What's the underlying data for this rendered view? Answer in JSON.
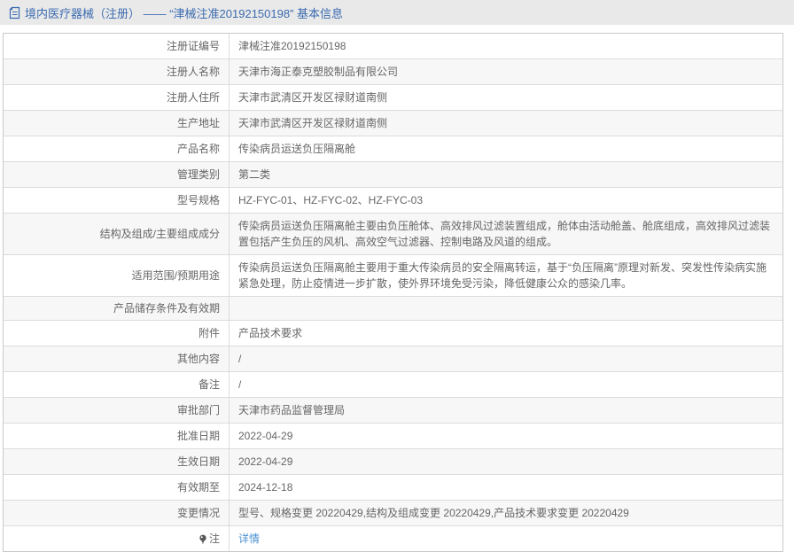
{
  "header": {
    "icon": "document-icon",
    "title": "境内医疗器械（注册） ——  “津械注准20192150198”  基本信息"
  },
  "table": {
    "rows": [
      {
        "label": "注册证编号",
        "value": "津械注准20192150198"
      },
      {
        "label": "注册人名称",
        "value": "天津市海正泰克塑胶制品有限公司"
      },
      {
        "label": "注册人住所",
        "value": "天津市武清区开发区禄财道南侧"
      },
      {
        "label": "生产地址",
        "value": "天津市武清区开发区禄财道南侧"
      },
      {
        "label": "产品名称",
        "value": "传染病员运送负压隔离舱"
      },
      {
        "label": "管理类别",
        "value": "第二类"
      },
      {
        "label": "型号规格",
        "value": "HZ-FYC-01、HZ-FYC-02、HZ-FYC-03"
      },
      {
        "label": "结构及组成/主要组成成分",
        "value": "传染病员运送负压隔离舱主要由负压舱体、高效排风过滤装置组成，舱体由活动舱盖、舱底组成，高效排风过滤装置包括产生负压的风机、高效空气过滤器、控制电路及风道的组成。"
      },
      {
        "label": "适用范围/预期用途",
        "value": "传染病员运送负压隔离舱主要用于重大传染病员的安全隔离转运，基于“负压隔离”原理对新发、突发性传染病实施紧急处理，防止疫情进一步扩散，使外界环境免受污染，降低健康公众的感染几率。"
      },
      {
        "label": "产品储存条件及有效期",
        "value": ""
      },
      {
        "label": "附件",
        "value": "产品技术要求"
      },
      {
        "label": "其他内容",
        "value": "/"
      },
      {
        "label": "备注",
        "value": "/"
      },
      {
        "label": "审批部门",
        "value": "天津市药品监督管理局"
      },
      {
        "label": "批准日期",
        "value": "2022-04-29"
      },
      {
        "label": "生效日期",
        "value": "2022-04-29"
      },
      {
        "label": "有效期至",
        "value": "2024-12-18"
      },
      {
        "label": "变更情况",
        "value": "型号、规格变更 20220429,结构及组成变更 20220429,产品技术要求变更 20220429"
      },
      {
        "label": "注",
        "value": "详情",
        "value_is_link": true,
        "label_icon": "pin-icon"
      }
    ]
  },
  "colors": {
    "header_bg": "#e9e9e9",
    "title_blue": "#3b6bb0",
    "link_blue": "#4a90d2",
    "row_stripe": "#f7f7f7",
    "border": "#dcdcdc",
    "text": "#666666"
  }
}
